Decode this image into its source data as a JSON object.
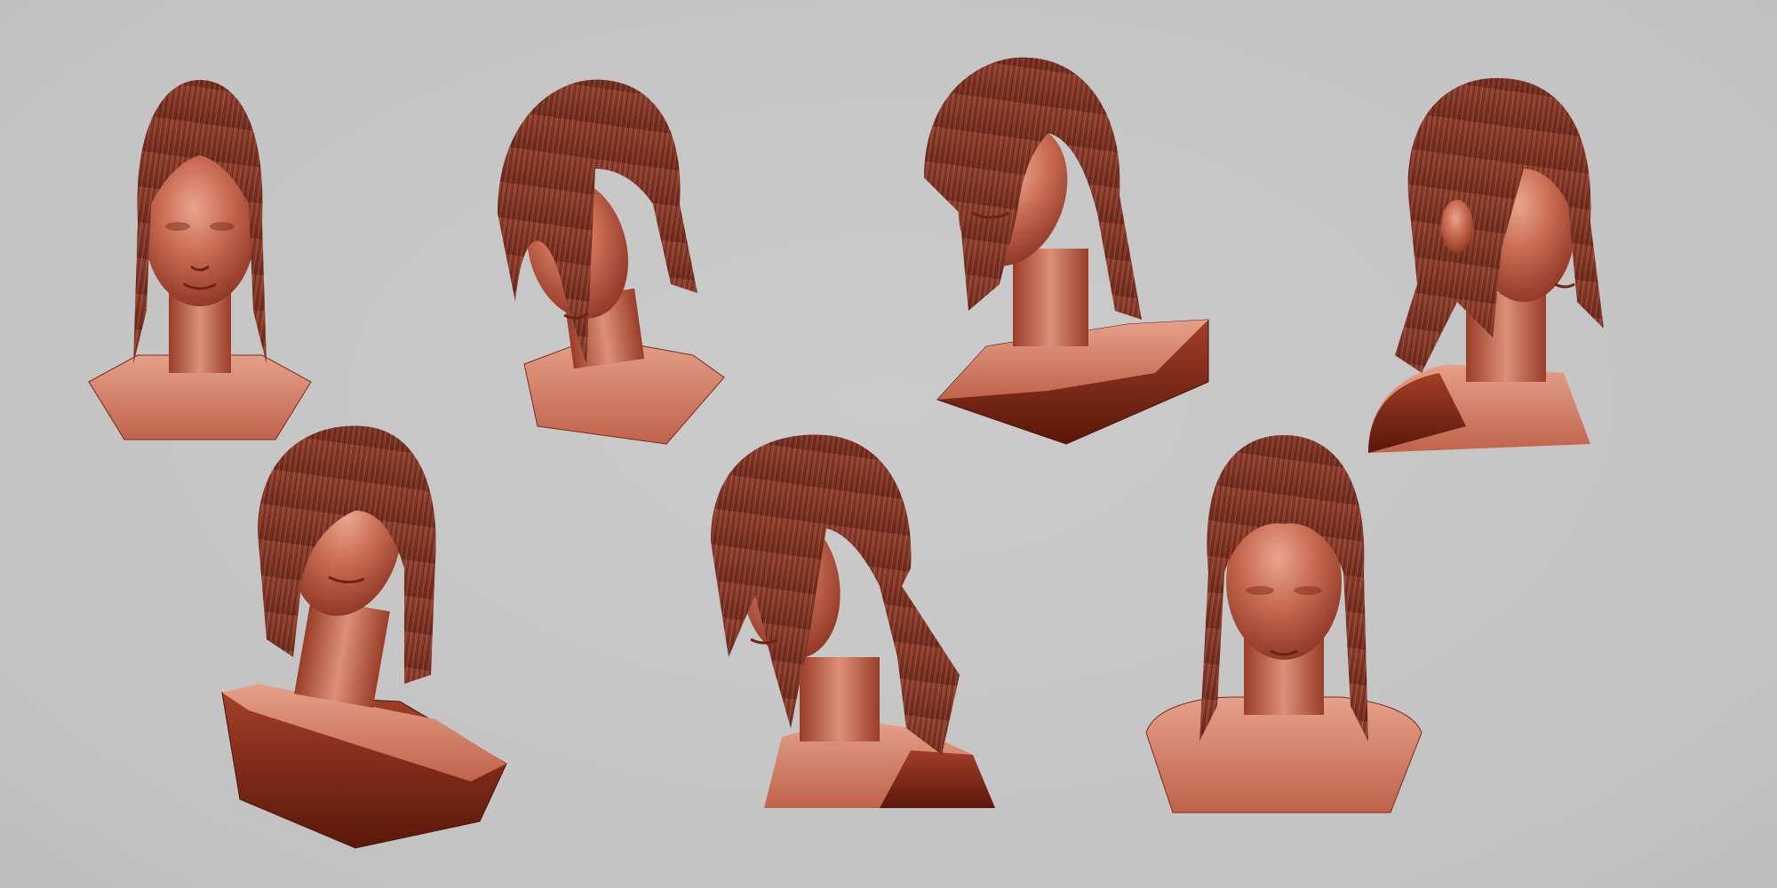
{
  "scene": {
    "description_visible_text": "",
    "background_color": "#c6c6c6",
    "material_color": "#b8553f",
    "material_shadow": "#6e1f10",
    "material_highlight": "#e8a58e",
    "hair_color": "#8a3b2c"
  },
  "busts": [
    {
      "view": "front"
    },
    {
      "view": "three-quarter-left-down"
    },
    {
      "view": "three-quarter-left-up"
    },
    {
      "view": "right-profile"
    },
    {
      "view": "low-angle-tilt"
    },
    {
      "view": "left-three-quarter"
    },
    {
      "view": "front-down"
    }
  ]
}
